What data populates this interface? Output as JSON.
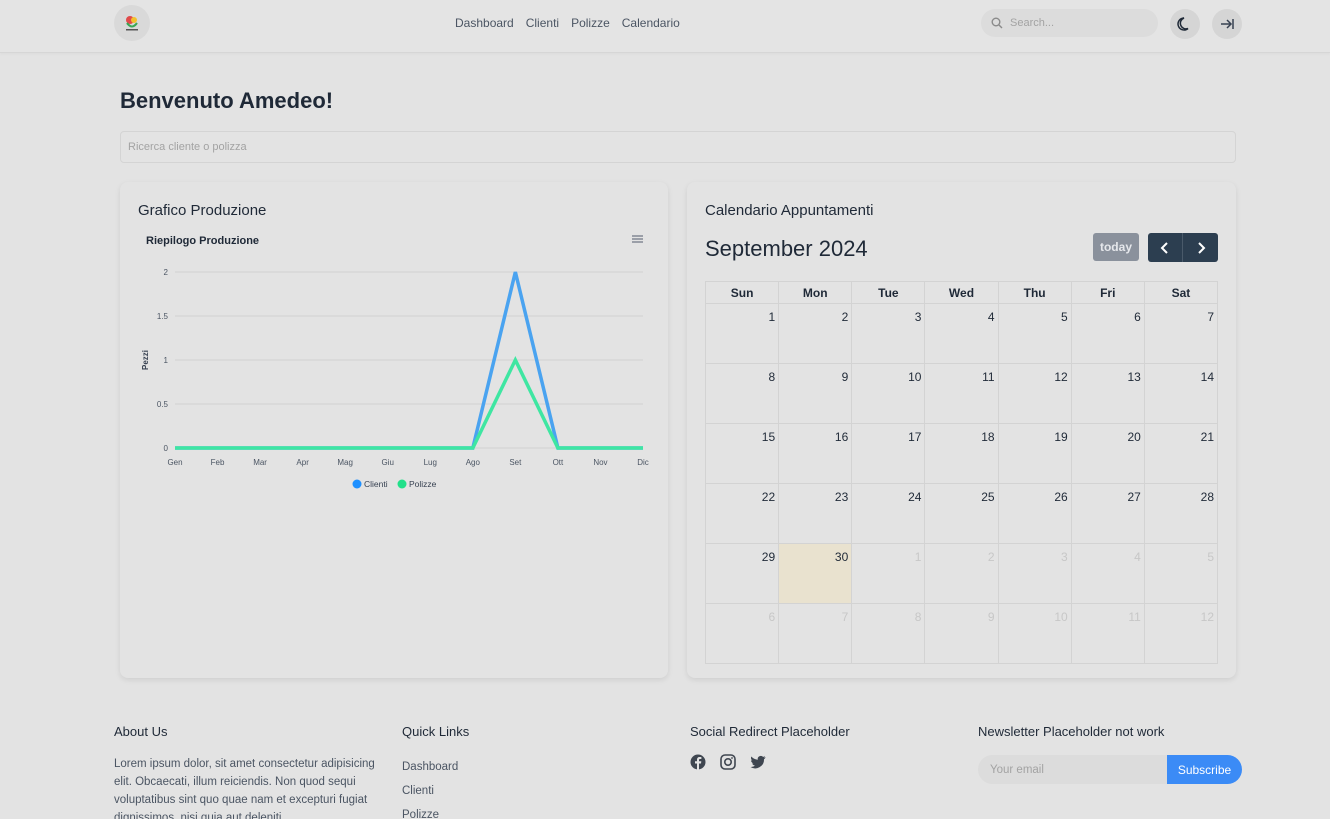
{
  "header": {
    "nav": [
      "Dashboard",
      "Clienti",
      "Polizze",
      "Calendario"
    ],
    "search_placeholder": "Search...",
    "icons": [
      "logo",
      "search-icon",
      "moon-icon",
      "logout-arrow-icon"
    ]
  },
  "main": {
    "welcome": "Benvenuto Amedeo!",
    "search_placeholder": "Ricerca cliente o polizza"
  },
  "production_card": {
    "title": "Grafico Produzione"
  },
  "chart_data": {
    "type": "line",
    "title": "Riepilogo Produzione",
    "xlabel": "",
    "ylabel": "Pezzi",
    "x": [
      "Gen",
      "Feb",
      "Mar",
      "Apr",
      "Mag",
      "Giu",
      "Lug",
      "Ago",
      "Set",
      "Ott",
      "Nov",
      "Dic"
    ],
    "ylim": [
      0,
      2
    ],
    "yticks": [
      "0",
      "0.5",
      "1",
      "1.5",
      "2"
    ],
    "series": [
      {
        "name": "Clienti",
        "values": [
          0,
          0,
          0,
          0,
          0,
          0,
          0,
          0,
          2,
          0,
          0,
          0
        ],
        "color": "#4aa3f0",
        "legend_color": "#1e90ff"
      },
      {
        "name": "Polizze",
        "values": [
          0,
          0,
          0,
          0,
          0,
          0,
          0,
          0,
          1,
          0,
          0,
          0
        ],
        "color": "#3fe6a2",
        "legend_color": "#22e08a"
      }
    ],
    "grid": true,
    "legend": "bottom",
    "menu_icon": "hamburger-icon"
  },
  "calendar": {
    "card_title": "Calendario Appuntamenti",
    "month_title": "September 2024",
    "today_label": "today",
    "weekdays": [
      "Sun",
      "Mon",
      "Tue",
      "Wed",
      "Thu",
      "Fri",
      "Sat"
    ],
    "weeks": [
      [
        "1",
        "2",
        "3",
        "4",
        "5",
        "6",
        "7"
      ],
      [
        "8",
        "9",
        "10",
        "11",
        "12",
        "13",
        "14"
      ],
      [
        "15",
        "16",
        "17",
        "18",
        "19",
        "20",
        "21"
      ],
      [
        "22",
        "23",
        "24",
        "25",
        "26",
        "27",
        "28"
      ],
      [
        "29",
        "30",
        "1",
        "2",
        "3",
        "4",
        "5"
      ],
      [
        "6",
        "7",
        "8",
        "9",
        "10",
        "11",
        "12"
      ]
    ],
    "highlight_color": "#e9e2cf"
  },
  "footer": {
    "about_title": "About Us",
    "about_text": "Lorem ipsum dolor, sit amet consectetur adipisicing elit. Obcaecati, illum reiciendis. Non quod sequi voluptatibus sint quo quae nam et excepturi fugiat dignissimos, nisi quia aut deleniti",
    "quick_title": "Quick Links",
    "quick_links": [
      "Dashboard",
      "Clienti",
      "Polizze"
    ],
    "social_title": "Social Redirect Placeholder",
    "social_icons": [
      "facebook-icon",
      "instagram-icon",
      "twitter-icon"
    ],
    "newsletter_title": "Newsletter Placeholder not work",
    "email_placeholder": "Your email",
    "subscribe_label": "Subscribe",
    "accent_color": "#3b8bf6"
  }
}
